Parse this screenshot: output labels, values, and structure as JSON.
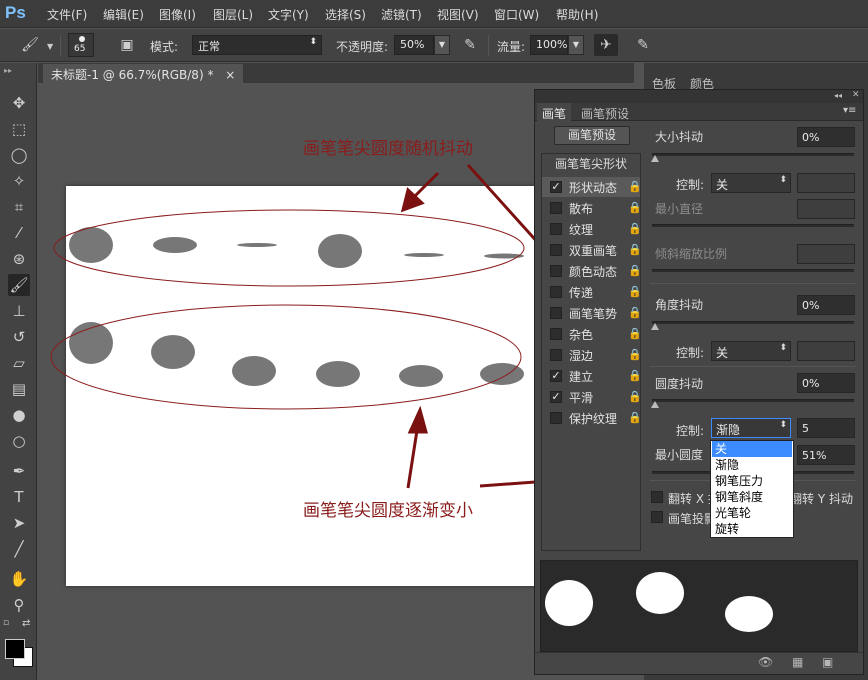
{
  "app": {
    "logo": "Ps"
  },
  "menu": [
    "文件(F)",
    "编辑(E)",
    "图像(I)",
    "图层(L)",
    "文字(Y)",
    "选择(S)",
    "滤镜(T)",
    "视图(V)",
    "窗口(W)",
    "帮助(H)"
  ],
  "options": {
    "brush_size": "65",
    "mode_label": "模式:",
    "mode_value": "正常",
    "opacity_label": "不透明度:",
    "opacity_value": "50%",
    "flow_label": "流量:",
    "flow_value": "100%"
  },
  "document": {
    "tab_title": "未标题-1 @ 66.7%(RGB/8) *",
    "close": "×"
  },
  "dock": {
    "tab_swatch": "色板",
    "tab_color": "颜色"
  },
  "brush_panel": {
    "tab_brush": "画笔",
    "tab_presets": "画笔预设",
    "preset_button": "画笔预设",
    "list_header": "画笔笔尖形状",
    "list": [
      {
        "label": "形状动态",
        "checked": "✓"
      },
      {
        "label": "散布",
        "checked": ""
      },
      {
        "label": "纹理",
        "checked": ""
      },
      {
        "label": "双重画笔",
        "checked": ""
      },
      {
        "label": "颜色动态",
        "checked": ""
      },
      {
        "label": "传递",
        "checked": ""
      },
      {
        "label": "画笔笔势",
        "checked": ""
      },
      {
        "label": "杂色",
        "checked": ""
      },
      {
        "label": "湿边",
        "checked": ""
      },
      {
        "label": "建立",
        "checked": "✓"
      },
      {
        "label": "平滑",
        "checked": "✓"
      },
      {
        "label": "保护纹理",
        "checked": ""
      }
    ],
    "size_jitter_label": "大小抖动",
    "size_jitter_value": "0%",
    "control_label": "控制:",
    "control_off": "关",
    "min_diameter_label": "最小直径",
    "tilt_scale_label": "倾斜缩放比例",
    "angle_jitter_label": "角度抖动",
    "angle_jitter_value": "0%",
    "roundness_jitter_label": "圆度抖动",
    "roundness_jitter_value": "0%",
    "roundness_control": "渐隐",
    "roundness_fade_steps": "5",
    "min_roundness_label": "最小圆度",
    "min_roundness_value": "51%",
    "flip_x_label": "翻转 X 抖动",
    "flip_y_label": "翻转 Y 抖动",
    "brush_projection_label": "画笔投影",
    "dropdown_options": [
      "关",
      "渐隐",
      "钢笔压力",
      "钢笔斜度",
      "光笔轮",
      "旋转"
    ],
    "dropdown_selected_index": 0
  },
  "annotations": {
    "top": "画笔笔尖圆度随机抖动",
    "bottom": "画笔笔尖圆度逐渐变小"
  },
  "colors": {
    "annotation": "#8b1c1c",
    "stroke_fill": "#777777",
    "accent": "#3c8cff"
  }
}
